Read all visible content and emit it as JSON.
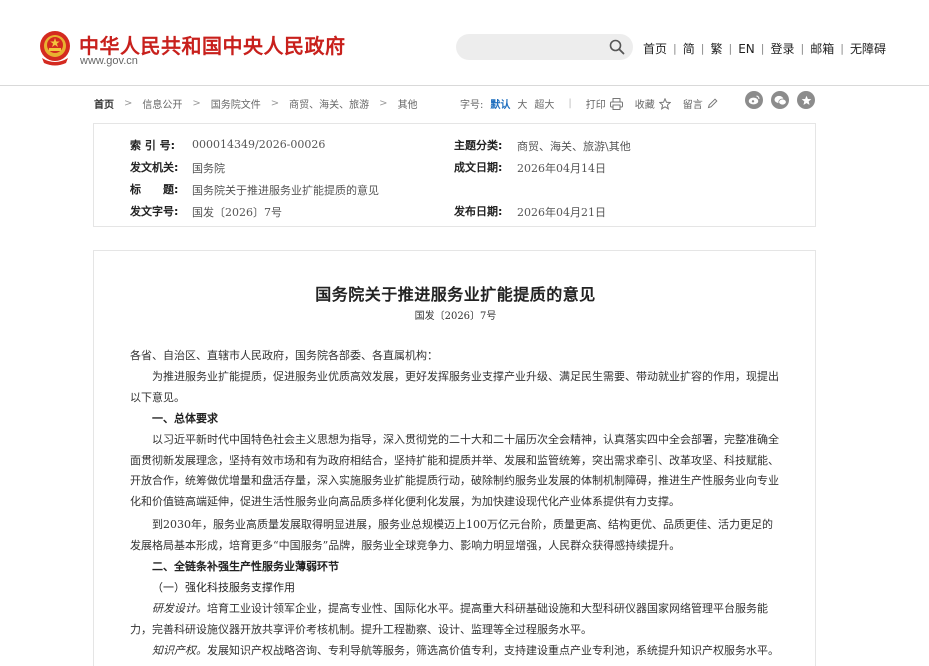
{
  "header": {
    "site_name": "中华人民共和国中央人民政府",
    "site_url": "www.gov.cn",
    "search_placeholder": "",
    "links": [
      "首页",
      "简",
      "繁",
      "EN",
      "登录",
      "邮箱",
      "无障碍"
    ],
    "brand_color": "#c8201c"
  },
  "breadcrumb": {
    "items": [
      "首页",
      "信息公开",
      "国务院文件",
      "商贸、海关、旅游",
      "其他"
    ]
  },
  "tools": {
    "font_size_label": "字号:",
    "font_sizes": [
      "默认",
      "大",
      "超大"
    ],
    "active_font_size": "默认",
    "print_label": "打印",
    "favorite_label": "收藏",
    "comment_label": "留言",
    "social_icons": [
      "weibo-icon",
      "wechat-icon",
      "star-circle-icon"
    ]
  },
  "info": {
    "index_label": "索 引 号:",
    "index_value": "000014349/2026-00026",
    "category_label": "主题分类:",
    "category_value": "商贸、海关、旅游\\其他",
    "issuer_label": "发文机关:",
    "issuer_value": "国务院",
    "date_written_label": "成文日期:",
    "date_written_value": "2026年04月14日",
    "title_label": "标　　题:",
    "title_value": "国务院关于推进服务业扩能提质的意见",
    "doc_no_label": "发文字号:",
    "doc_no_value": "国发〔2026〕7号",
    "published_label": "发布日期:",
    "published_value": "2026年04月21日"
  },
  "article": {
    "title": "国务院关于推进服务业扩能提质的意见",
    "doc_no": "国发〔2026〕7号",
    "salutation": "各省、自治区、直辖市人民政府，国务院各部委、各直属机构：",
    "intro": "为推进服务业扩能提质，促进服务业优质高效发展，更好发挥服务业支撑产业升级、满足民生需要、带动就业扩容的作用，现提出以下意见。",
    "section1": "一、总体要求",
    "para1": "以习近平新时代中国特色社会主义思想为指导，深入贯彻党的二十大和二十届历次全会精神，认真落实四中全会部署，完整准确全面贯彻新发展理念，坚持有效市场和有为政府相结合，坚持扩能和提质并举、发展和监管统筹，突出需求牵引、改革攻坚、科技赋能、开放合作，统筹做优增量和盘活存量，深入实施服务业扩能提质行动，破除制约服务业发展的体制机制障碍，推进生产性服务业向专业化和价值链高端延伸，促进生活性服务业向高品质多样化便利化发展，为加快建设现代化产业体系提供有力支撑。",
    "para2": "到2030年，服务业高质量发展取得明显进展，服务业总规模迈上100万亿元台阶，质量更高、结构更优、品质更佳、活力更足的发展格局基本形成，培育更多“中国服务”品牌，服务业全球竞争力、影响力明显增强，人民群众获得感持续提升。",
    "section2": "二、全链条补强生产性服务业薄弱环节",
    "sub1": "（一）强化科技服务支撑作用",
    "kw1": "研发设计。",
    "para3": "培育工业设计领军企业，提高专业性、国际化水平。提高重大科研基础设施和大型科研仪器国家网络管理平台服务能力，完善科研设施仪器开放共享评价考核机制。提升工程勘察、设计、监理等全过程服务水平。",
    "kw2": "知识产权。",
    "para4": "发展知识产权战略咨询、专利导航等服务，筛选高价值专利，支持建设重点产业专利池，系统提升知识产权服务水平。"
  }
}
